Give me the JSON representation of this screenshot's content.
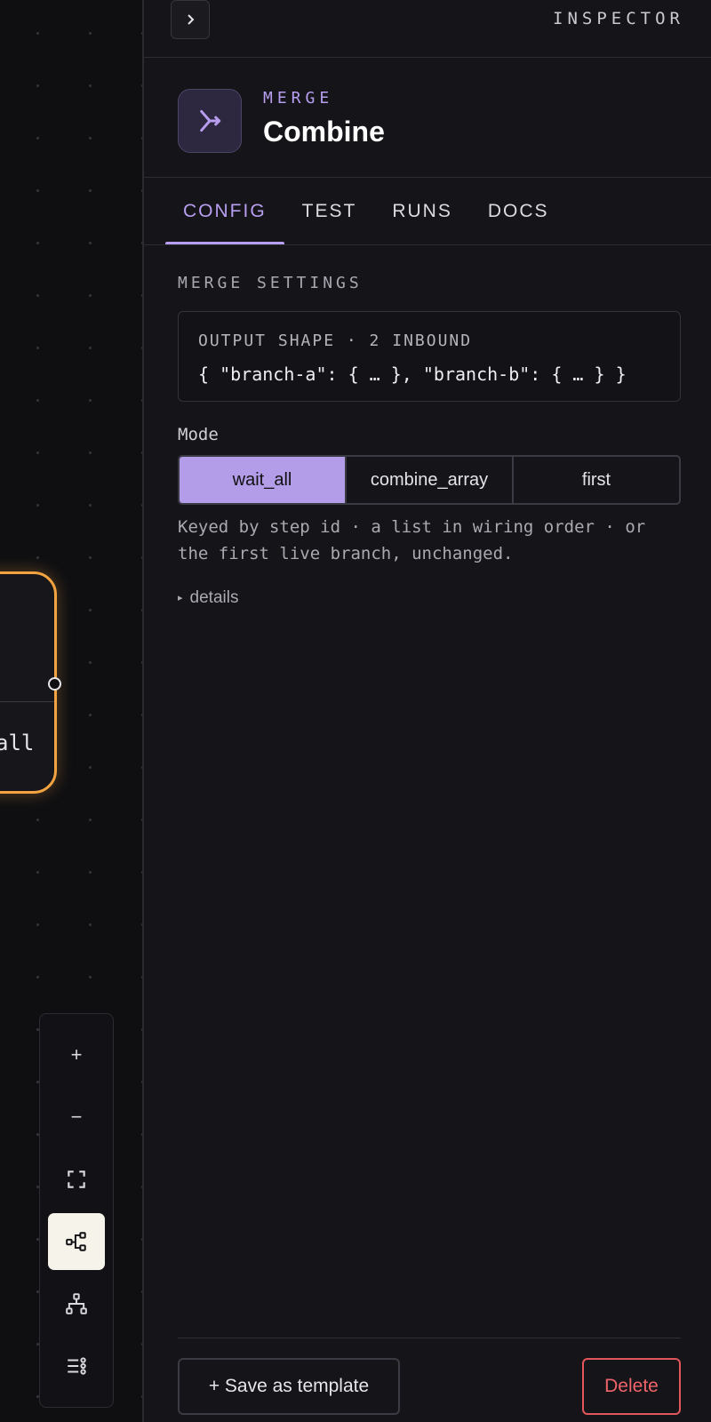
{
  "canvas": {
    "node_text": "all",
    "toolbar": {
      "zoom_in": "+",
      "zoom_out": "−"
    }
  },
  "inspector": {
    "title": "INSPECTOR",
    "node": {
      "kind": "MERGE",
      "name": "Combine",
      "icon": "merge-icon"
    },
    "tabs": [
      {
        "label": "CONFIG",
        "active": true
      },
      {
        "label": "TEST",
        "active": false
      },
      {
        "label": "RUNS",
        "active": false
      },
      {
        "label": "DOCS",
        "active": false
      }
    ],
    "section_title": "MERGE SETTINGS",
    "output_shape": {
      "label": "OUTPUT SHAPE · 2 INBOUND",
      "value": "{ \"branch-a\": { … }, \"branch-b\": { … } }"
    },
    "mode": {
      "label": "Mode",
      "options": [
        "wait_all",
        "combine_array",
        "first"
      ],
      "selected": "wait_all",
      "help": "Keyed by step id · a list in wiring order · or the first live branch, unchanged."
    },
    "details_label": "details",
    "footer": {
      "save_template": "+ Save as template",
      "delete": "Delete"
    }
  },
  "colors": {
    "accent": "#b89ef0",
    "node_highlight": "#f3a33f",
    "danger": "#ef6469"
  }
}
